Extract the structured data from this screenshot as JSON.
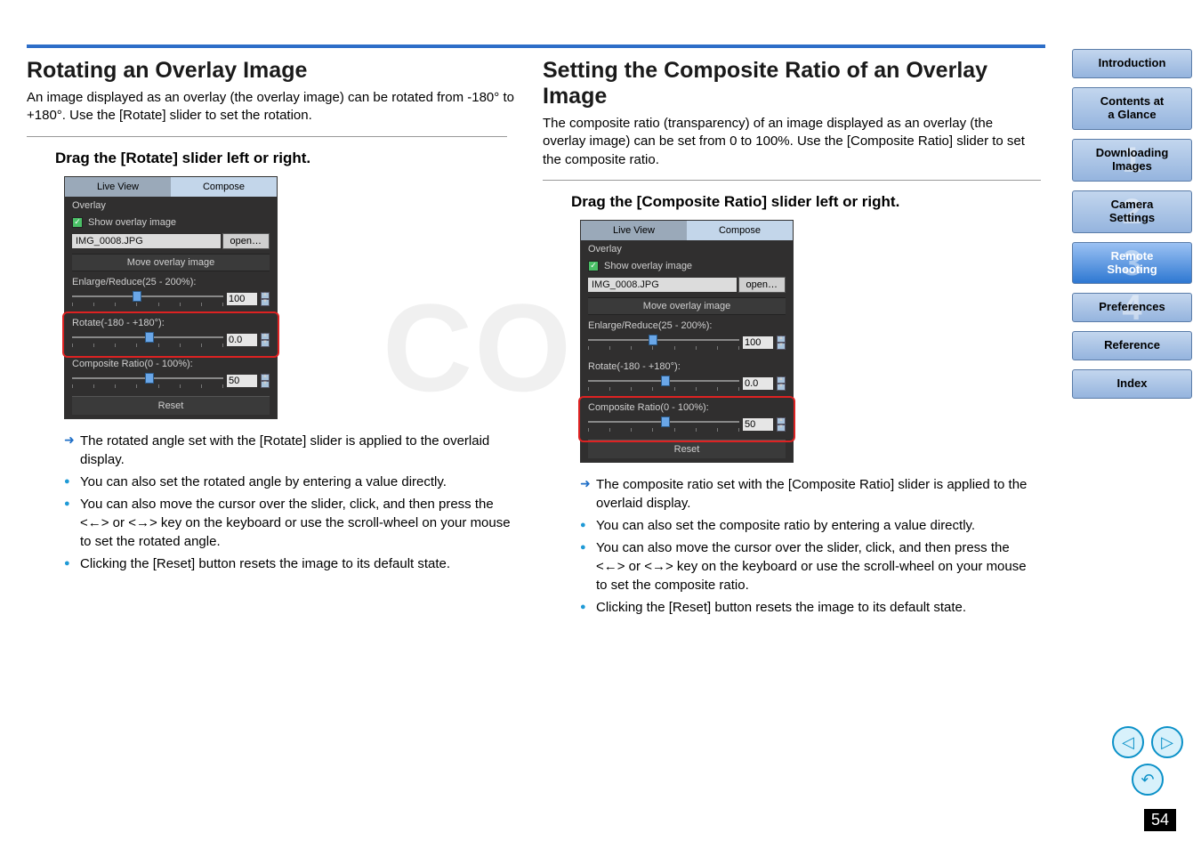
{
  "topbar": {},
  "left": {
    "title": "Rotating an Overlay Image",
    "intro": "An image displayed as an overlay (the overlay image) can be rotated from -180° to +180°. Use the [Rotate] slider to set the rotation.",
    "instruction": "Drag the [Rotate] slider left or right.",
    "notes": [
      "The rotated angle set with the [Rotate] slider is applied to the overlaid display.",
      "You can also set the rotated angle by entering a value directly.",
      "You can also move the cursor over the slider, click, and then press the <←> or <→> key on the keyboard or use the scroll-wheel on your mouse to set the rotated angle.",
      "Clicking the [Reset] button resets the image to its default state."
    ]
  },
  "right": {
    "title": "Setting the Composite Ratio of an Overlay Image",
    "intro": "The composite ratio (transparency) of an image displayed as an overlay (the overlay image) can be set from 0 to 100%. Use the [Composite Ratio] slider to set the composite ratio.",
    "instruction": "Drag the [Composite Ratio] slider left or right.",
    "notes": [
      "The composite ratio set with the [Composite Ratio] slider is applied to the overlaid display.",
      "You can also set the composite ratio by entering a value directly.",
      "You can also move the cursor over the slider, click, and then press the <←> or <→> key on the keyboard or use the scroll-wheel on your mouse to set the composite ratio.",
      "Clicking the [Reset] button resets the image to its default state."
    ]
  },
  "panel": {
    "tab_live": "Live View",
    "tab_compose": "Compose",
    "overlay_label": "Overlay",
    "show_overlay": "Show overlay image",
    "filename": "IMG_0008.JPG",
    "open": "open…",
    "move": "Move overlay image",
    "enlarge_label": "Enlarge/Reduce(25 - 200%):",
    "enlarge_val": "100",
    "rotate_label": "Rotate(-180 - +180°):",
    "rotate_val": "0.0",
    "comp_label": "Composite Ratio(0 - 100%):",
    "comp_val": "50",
    "reset": "Reset"
  },
  "sidebar": [
    {
      "label": "Introduction",
      "num": ""
    },
    {
      "label": "Contents at\na Glance",
      "num": ""
    },
    {
      "label": "Downloading\nImages",
      "num": "1"
    },
    {
      "label": "Camera\nSettings",
      "num": "2"
    },
    {
      "label": "Remote\nShooting",
      "num": "3",
      "active": true
    },
    {
      "label": "Preferences",
      "num": "4"
    },
    {
      "label": "Reference",
      "num": ""
    },
    {
      "label": "Index",
      "num": ""
    }
  ],
  "page_number": "54"
}
